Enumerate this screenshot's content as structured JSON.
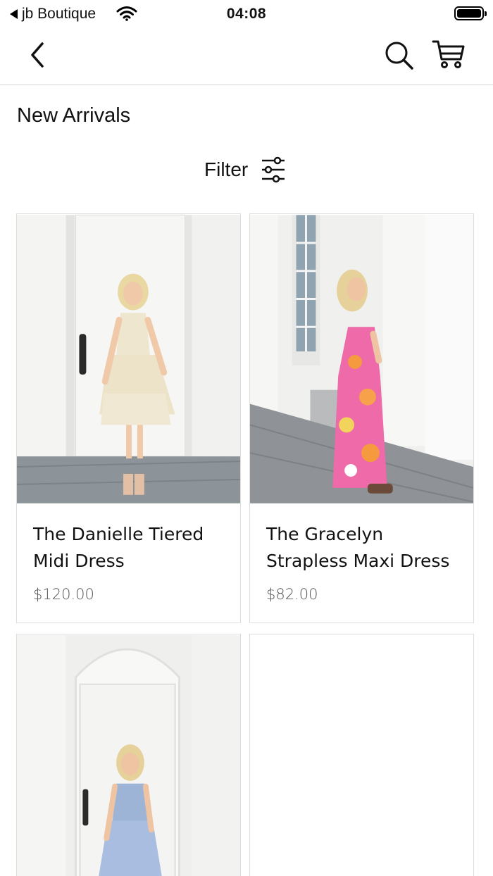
{
  "status_bar": {
    "back_app": "jb Boutique",
    "time": "04:08"
  },
  "nav": {
    "icons": [
      "chevron-left-icon",
      "search-icon",
      "cart-icon"
    ]
  },
  "page": {
    "title": "New Arrivals",
    "filter_label": "Filter",
    "filter_icon": "sliders-icon"
  },
  "products": [
    {
      "name": "The Danielle Tiered Midi Dress",
      "price": "$120.00",
      "dress_color": "#efe6cf"
    },
    {
      "name": "The Gracelyn Strapless Maxi Dress",
      "price": "$82.00",
      "dress_color": "#ee6aa9"
    },
    {
      "name": "",
      "price": "",
      "dress_color": "#9db4d6"
    }
  ],
  "colors": {
    "divider": "#d4d4d4",
    "card_border": "#dedede",
    "price_text": "#555555"
  }
}
